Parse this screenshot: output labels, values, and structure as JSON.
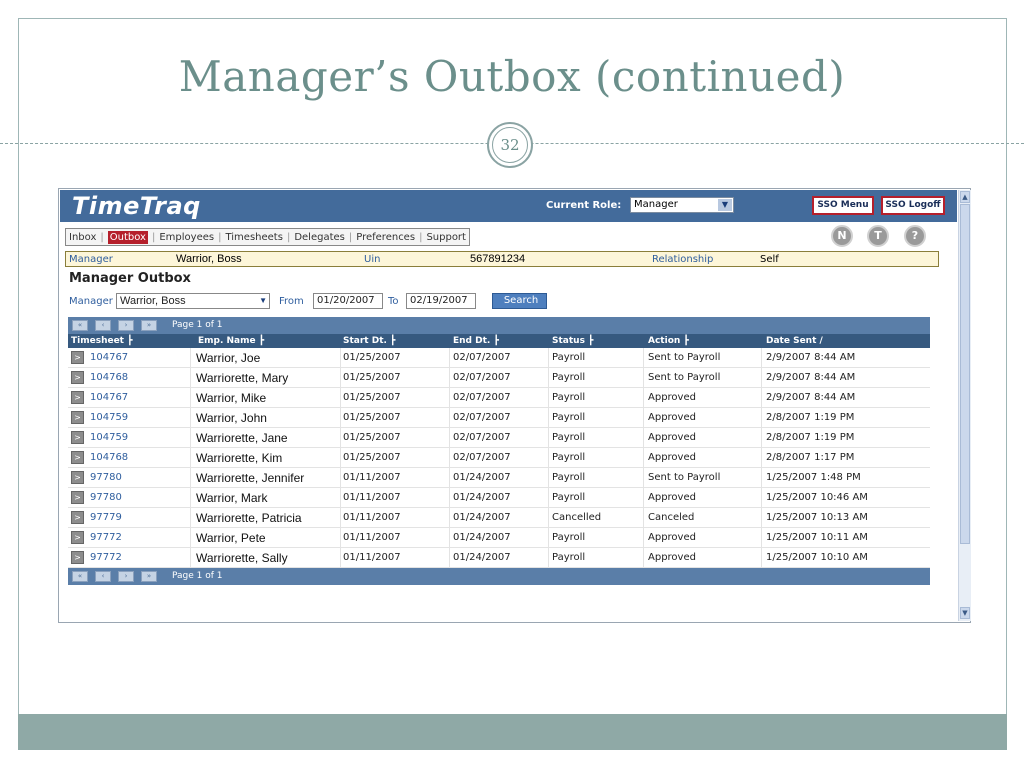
{
  "slide": {
    "title": "Manager’s Outbox (continued)",
    "page_number": "32"
  },
  "app": {
    "logo": "TimeTraq",
    "current_role_label": "Current Role:",
    "current_role_value": "Manager",
    "sso_menu": "SSO Menu",
    "sso_logoff": "SSO Logoff",
    "nav": [
      "Inbox",
      "Outbox",
      "Employees",
      "Timesheets",
      "Delegates",
      "Preferences",
      "Support"
    ],
    "nav_active": "Outbox",
    "circle_buttons": [
      "N",
      "T",
      "?"
    ],
    "info": {
      "role": "Manager",
      "name": "Warrior, Boss",
      "uin_label": "Uin",
      "uin_value": "567891234",
      "relationship_label": "Relationship",
      "relationship_value": "Self"
    },
    "outbox_title": "Manager Outbox",
    "filter": {
      "manager_label": "Manager",
      "manager_value": "Warrior, Boss",
      "from_label": "From",
      "from_value": "01/20/2007",
      "to_label": "To",
      "to_value": "02/19/2007",
      "search_label": "Search"
    },
    "pager_text": "Page 1 of 1",
    "columns": [
      "Timesheet  ┣",
      "Emp. Name  ┣",
      "Start Dt.  ┣",
      "End Dt.  ┣",
      "Status  ┣",
      "Action  ┣",
      "Date Sent  /"
    ],
    "rows": [
      {
        "timesheet": "104767",
        "name": "Warrior, Joe",
        "start": "01/25/2007",
        "end": "02/07/2007",
        "status": "Payroll",
        "action": "Sent to Payroll",
        "sent": "2/9/2007 8:44 AM"
      },
      {
        "timesheet": "104768",
        "name": "Warriorette, Mary",
        "start": "01/25/2007",
        "end": "02/07/2007",
        "status": "Payroll",
        "action": "Sent to Payroll",
        "sent": "2/9/2007 8:44 AM"
      },
      {
        "timesheet": "104767",
        "name": "Warrior, Mike",
        "start": "01/25/2007",
        "end": "02/07/2007",
        "status": "Payroll",
        "action": "Approved",
        "sent": "2/9/2007 8:44 AM"
      },
      {
        "timesheet": "104759",
        "name": "Warrior, John",
        "start": "01/25/2007",
        "end": "02/07/2007",
        "status": "Payroll",
        "action": "Approved",
        "sent": "2/8/2007 1:19 PM"
      },
      {
        "timesheet": "104759",
        "name": "Warriorette, Jane",
        "start": "01/25/2007",
        "end": "02/07/2007",
        "status": "Payroll",
        "action": "Approved",
        "sent": "2/8/2007 1:19 PM"
      },
      {
        "timesheet": "104768",
        "name": "Warriorette, Kim",
        "start": "01/25/2007",
        "end": "02/07/2007",
        "status": "Payroll",
        "action": "Approved",
        "sent": "2/8/2007 1:17 PM"
      },
      {
        "timesheet": "97780",
        "name": "Warriorette, Jennifer",
        "start": "01/11/2007",
        "end": "01/24/2007",
        "status": "Payroll",
        "action": "Sent to Payroll",
        "sent": "1/25/2007 1:48 PM"
      },
      {
        "timesheet": "97780",
        "name": "Warrior, Mark",
        "start": "01/11/2007",
        "end": "01/24/2007",
        "status": "Payroll",
        "action": "Approved",
        "sent": "1/25/2007 10:46 AM"
      },
      {
        "timesheet": "97779",
        "name": "Warriorette, Patricia",
        "start": "01/11/2007",
        "end": "01/24/2007",
        "status": "Cancelled",
        "action": "Canceled",
        "sent": "1/25/2007 10:13 AM"
      },
      {
        "timesheet": "97772",
        "name": "Warrior, Pete",
        "start": "01/11/2007",
        "end": "01/24/2007",
        "status": "Payroll",
        "action": "Approved",
        "sent": "1/25/2007 10:11 AM"
      },
      {
        "timesheet": "97772",
        "name": "Warriorette, Sally",
        "start": "01/11/2007",
        "end": "01/24/2007",
        "status": "Payroll",
        "action": "Approved",
        "sent": "1/25/2007 10:10 AM"
      }
    ]
  },
  "colors": {
    "header_blue": "#436b9b",
    "grid_header": "#36597f",
    "active_tab": "#b51f2b",
    "slide_accent": "#6b8f8b",
    "footer_band": "#8fa9a6"
  }
}
